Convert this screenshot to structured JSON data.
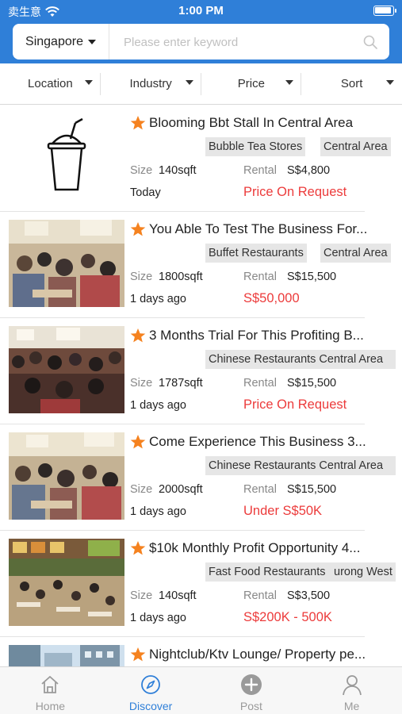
{
  "status_bar": {
    "carrier": "卖生意",
    "time": "1:00 PM"
  },
  "header": {
    "city": "Singapore",
    "search_placeholder": "Please enter keyword",
    "search_value": ""
  },
  "filters": [
    "Location",
    "Industry",
    "Price",
    "Sort"
  ],
  "labels": {
    "size": "Size",
    "rental": "Rental"
  },
  "listings": [
    {
      "title": "Blooming Bbt Stall In Central Area",
      "tags": [
        "Bubble Tea Stores",
        "Central Area"
      ],
      "size": "140sqft",
      "rental": "S$4,800",
      "date": "Today",
      "price": "Price On Request",
      "image": "bubble-tea-icon"
    },
    {
      "title": "You Able To Test The Business For...",
      "tags": [
        "Buffet Restaurants",
        "Central Area"
      ],
      "size": "1800sqft",
      "rental": "S$15,500",
      "date": "1 days ago",
      "price": "S$50,000",
      "image": "restaurant-photo"
    },
    {
      "title": "3 Months Trial For This Profiting B...",
      "tags": [
        "Chinese Restaurants Central Area"
      ],
      "size": "1787sqft",
      "rental": "S$15,500",
      "date": "1 days ago",
      "price": "Price On Request",
      "image": "restaurant-photo"
    },
    {
      "title": "Come Experience This Business 3...",
      "tags": [
        "Chinese Restaurants Central Area"
      ],
      "size": "2000sqft",
      "rental": "S$15,500",
      "date": "1 days ago",
      "price": "Under S$50K",
      "image": "restaurant-photo"
    },
    {
      "title": "$10k Monthly Profit Opportunity 4...",
      "tags": [
        "Fast Food Restaurants",
        "urong West"
      ],
      "size": "140sqft",
      "rental": "S$3,500",
      "date": "1 days ago",
      "price": "S$200K - 500K",
      "image": "food-court-photo"
    },
    {
      "title": "Nightclub/Ktv Lounge/ Property pe...",
      "tags": [],
      "size": "",
      "rental": "",
      "date": "",
      "price": "",
      "image": "building-photo"
    }
  ],
  "tabs": [
    {
      "label": "Home",
      "icon": "home-icon",
      "active": false
    },
    {
      "label": "Discover",
      "icon": "compass-icon",
      "active": true
    },
    {
      "label": "Post",
      "icon": "plus-circle-icon",
      "active": false
    },
    {
      "label": "Me",
      "icon": "person-icon",
      "active": false
    }
  ],
  "colors": {
    "brand_blue": "#2f7fd8",
    "price_red": "#ec3b3b",
    "star_orange": "#f5821f"
  }
}
